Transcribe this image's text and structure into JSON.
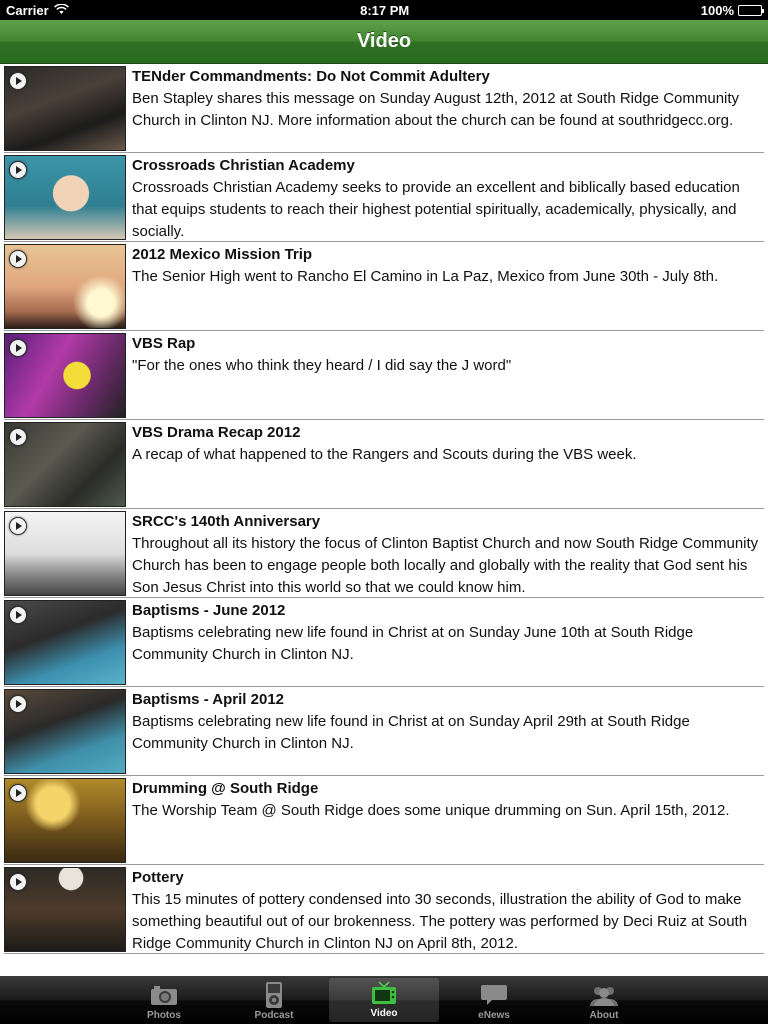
{
  "status_bar": {
    "carrier": "Carrier",
    "time": "8:17 PM",
    "battery": "100%",
    "battery_level": 1.0
  },
  "nav": {
    "title": "Video"
  },
  "videos": [
    {
      "title": "TENder Commandments: Do Not Commit Adultery",
      "description": "Ben Stapley shares this message on Sunday August 12th, 2012 at South Ridge Community Church in Clinton NJ. More information about the church can be found at southridgecc.org."
    },
    {
      "title": "Crossroads Christian Academy",
      "description": "Crossroads Christian Academy seeks to provide an excellent and biblically based education that equips students to reach their highest potential spiritually, academically, physically, and socially."
    },
    {
      "title": "2012 Mexico Mission Trip",
      "description": "The Senior High went to Rancho El Camino in La Paz, Mexico from June 30th - July 8th."
    },
    {
      "title": "VBS Rap",
      "description": "\"For the ones who think they heard / I did say the J word\""
    },
    {
      "title": "VBS Drama Recap 2012",
      "description": "A recap of what happened to the Rangers and Scouts during the VBS week."
    },
    {
      "title": "SRCC's 140th Anniversary",
      "description": "Throughout all its history the focus of Clinton Baptist Church and now South Ridge Community Church has been to engage people both locally and globally with the reality that God sent his Son Jesus Christ into this world so that we could know him."
    },
    {
      "title": "Baptisms - June 2012",
      "description": "Baptisms celebrating new life found in Christ at on Sunday June 10th at South Ridge Community Church in Clinton NJ."
    },
    {
      "title": "Baptisms - April 2012",
      "description": "Baptisms celebrating new life found in Christ at on Sunday April 29th at South Ridge Community Church in Clinton NJ."
    },
    {
      "title": "Drumming @ South Ridge",
      "description": "The Worship Team @ South Ridge does some unique drumming on Sun. April 15th, 2012."
    },
    {
      "title": "Pottery",
      "description": "This 15 minutes of pottery condensed into 30 seconds, illustration the ability of God to make something beautiful out of our brokenness. The pottery was performed by Deci Ruiz at South Ridge Community Church in Clinton NJ on April 8th, 2012."
    }
  ],
  "tabs": [
    {
      "label": "Photos",
      "icon": "camera-icon",
      "active": false
    },
    {
      "label": "Podcast",
      "icon": "ipod-icon",
      "active": false
    },
    {
      "label": "Video",
      "icon": "tv-icon",
      "active": true
    },
    {
      "label": "eNews",
      "icon": "speech-bubble-icon",
      "active": false
    },
    {
      "label": "About",
      "icon": "people-icon",
      "active": false
    }
  ],
  "colors": {
    "nav_green": "#3f8430",
    "tab_bar": "#000000",
    "active_tab_text": "#ffffff",
    "inactive_tab_text": "#9a9a9a"
  }
}
